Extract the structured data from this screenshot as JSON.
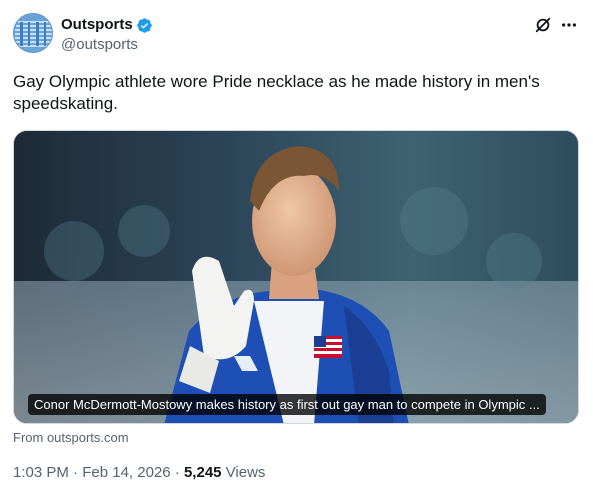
{
  "author": {
    "display_name": "Outsports",
    "handle": "@outsports",
    "verified": true,
    "avatar_icon": "outsports-logo-avatar"
  },
  "header_icons": {
    "grok": "grok-icon",
    "more": "more-icon"
  },
  "tweet": {
    "text": "Gay Olympic athlete wore Pride necklace as he made history in men's speedskating."
  },
  "media": {
    "caption": "Conor McDermott-Mostowy makes history as first out gay man to compete in Olympic ..."
  },
  "link_source": "From outsports.com",
  "meta": {
    "time": "1:03 PM",
    "separator": "·",
    "date": "Feb 14, 2026",
    "views_count": "5,245",
    "views_label": "Views"
  },
  "colors": {
    "text_primary": "#0f1419",
    "text_secondary": "#536471",
    "verified_blue": "#1d9bf0",
    "avatar_blue": "#6aa4d6"
  }
}
